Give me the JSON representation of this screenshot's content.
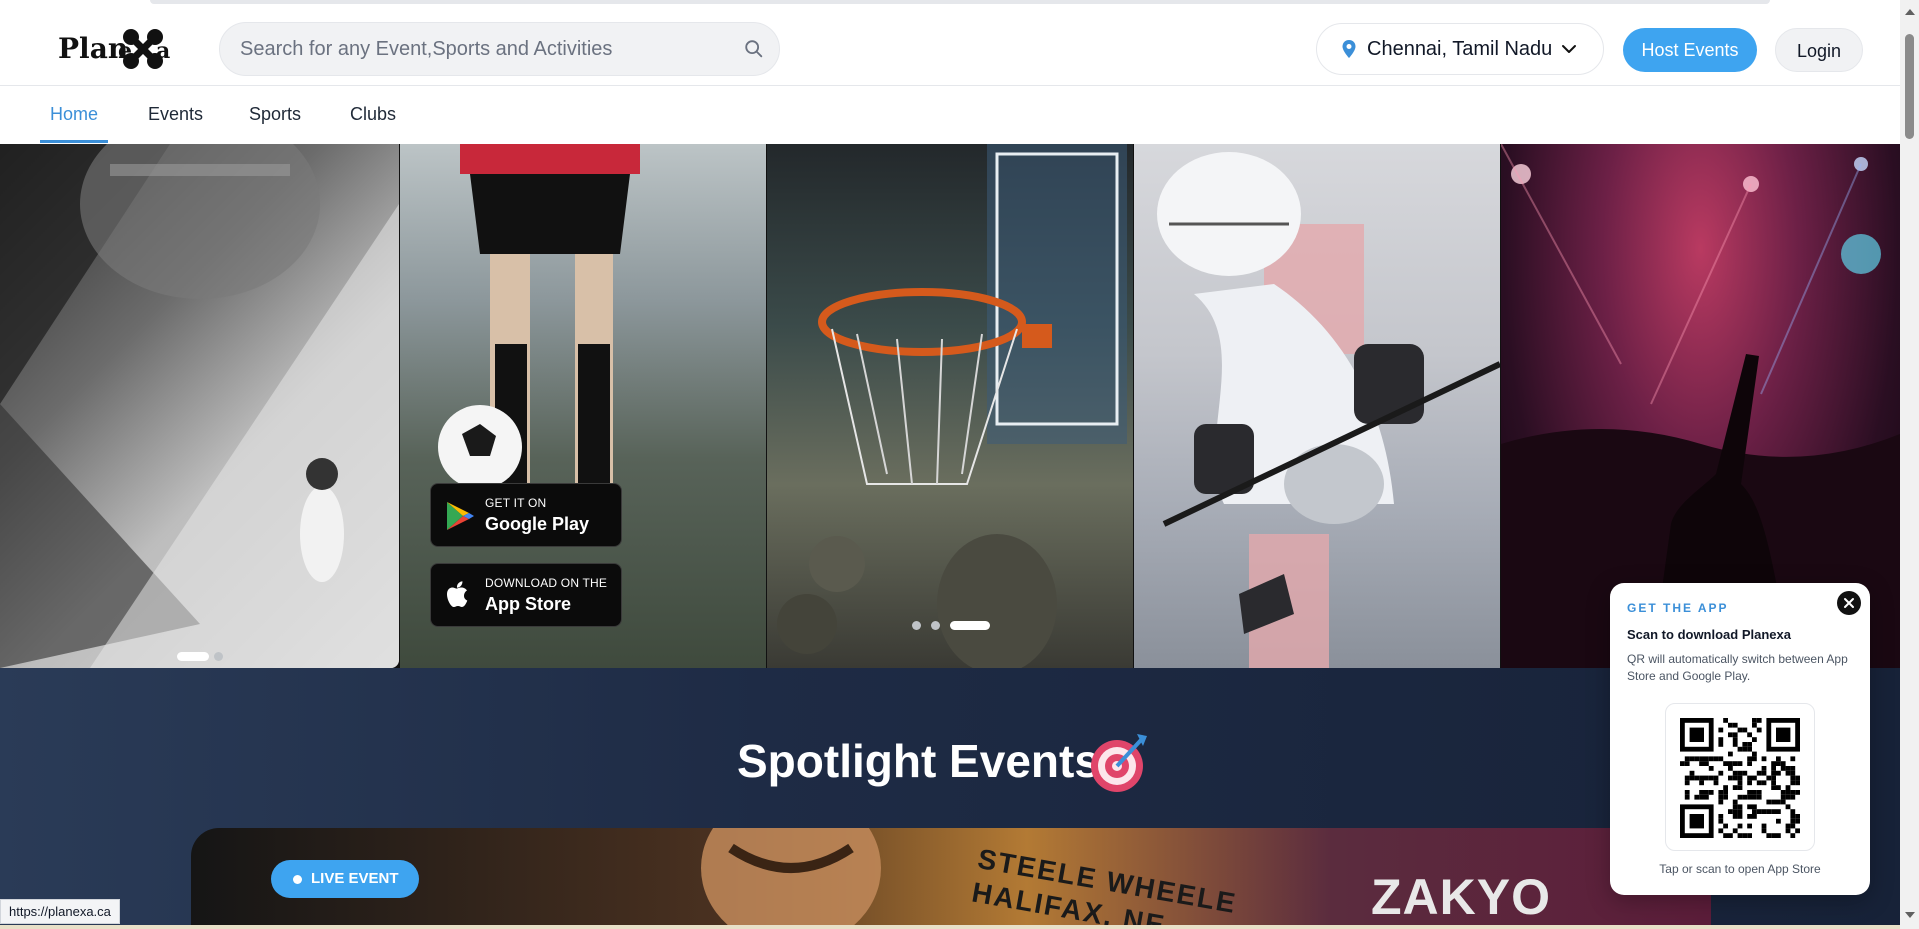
{
  "header": {
    "brand": "Planexa",
    "search_placeholder": "Search for any Event,Sports and Activities",
    "location": "Chennai, Tamil Nadu",
    "host_label": "Host Events",
    "login_label": "Login"
  },
  "nav": {
    "tabs": [
      {
        "label": "Home",
        "active": true
      },
      {
        "label": "Events",
        "active": false
      },
      {
        "label": "Sports",
        "active": false
      },
      {
        "label": "Clubs",
        "active": false
      }
    ]
  },
  "hero": {
    "google_play": {
      "small": "GET IT ON",
      "big": "Google Play"
    },
    "app_store": {
      "small": "DOWNLOAD ON THE",
      "big": "App Store"
    },
    "carousel_left": {
      "count": 2,
      "active_index": 0
    },
    "carousel_center": {
      "count": 3,
      "active_index": 2
    }
  },
  "spotlight": {
    "title": "Spotlight Events",
    "live_badge": "LIVE EVENT",
    "card_text_1": "STEELE WHEELE\nHALIFAX, NE",
    "card_text_2": "ZAKYO"
  },
  "popup": {
    "kicker": "GET THE APP",
    "title": "Scan to download Planexa",
    "description": "QR will automatically switch between App Store and Google Play.",
    "hint": "Tap or scan to open App Store"
  },
  "status_url": "https://planexa.ca",
  "colors": {
    "accent": "#3ea4f0",
    "nav_active": "#3b8fd8",
    "spotlight_bg": "#1e2b45"
  }
}
